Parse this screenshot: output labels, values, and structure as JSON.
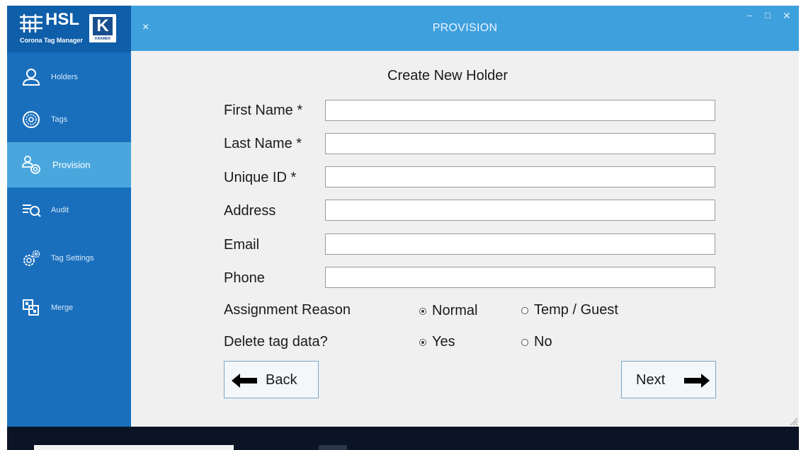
{
  "app": {
    "logo_text": "HSL",
    "logo_subtitle": "Corona Tag Manager",
    "logo_k": "K",
    "logo_kramer": "KRAMER"
  },
  "titlebar": {
    "close_symbol": "×",
    "title": "PROVISION",
    "minimize_symbol": "–",
    "maximize_symbol": "□",
    "window_close_symbol": "✕"
  },
  "sidebar": {
    "items": [
      {
        "label": "Holders",
        "icon": "person-icon"
      },
      {
        "label": "Tags",
        "icon": "tag-icon"
      },
      {
        "label": "Provision",
        "icon": "provision-icon",
        "active": true
      },
      {
        "label": "Audit",
        "icon": "audit-icon"
      },
      {
        "label": "Tag Settings",
        "icon": "gears-icon"
      },
      {
        "label": "Merge",
        "icon": "merge-icon"
      }
    ]
  },
  "form": {
    "title": "Create New Holder",
    "fields": [
      {
        "label": "First Name *",
        "value": ""
      },
      {
        "label": "Last Name *",
        "value": ""
      },
      {
        "label": "Unique ID *",
        "value": ""
      },
      {
        "label": "Address",
        "value": ""
      },
      {
        "label": "Email",
        "value": ""
      },
      {
        "label": "Phone",
        "value": ""
      }
    ],
    "assignment_reason": {
      "label": "Assignment Reason",
      "options": [
        "Normal",
        "Temp / Guest"
      ],
      "selected": "Normal"
    },
    "delete_tag_data": {
      "label": "Delete tag data?",
      "options": [
        "Yes",
        "No"
      ],
      "selected": "Yes"
    },
    "back_label": "Back",
    "next_label": "Next"
  },
  "colors": {
    "sidebar": "#1a6fbd",
    "sidebar_active": "#4aa7de",
    "titlebar": "#3fa0de",
    "content_bg": "#f0f0f0"
  }
}
